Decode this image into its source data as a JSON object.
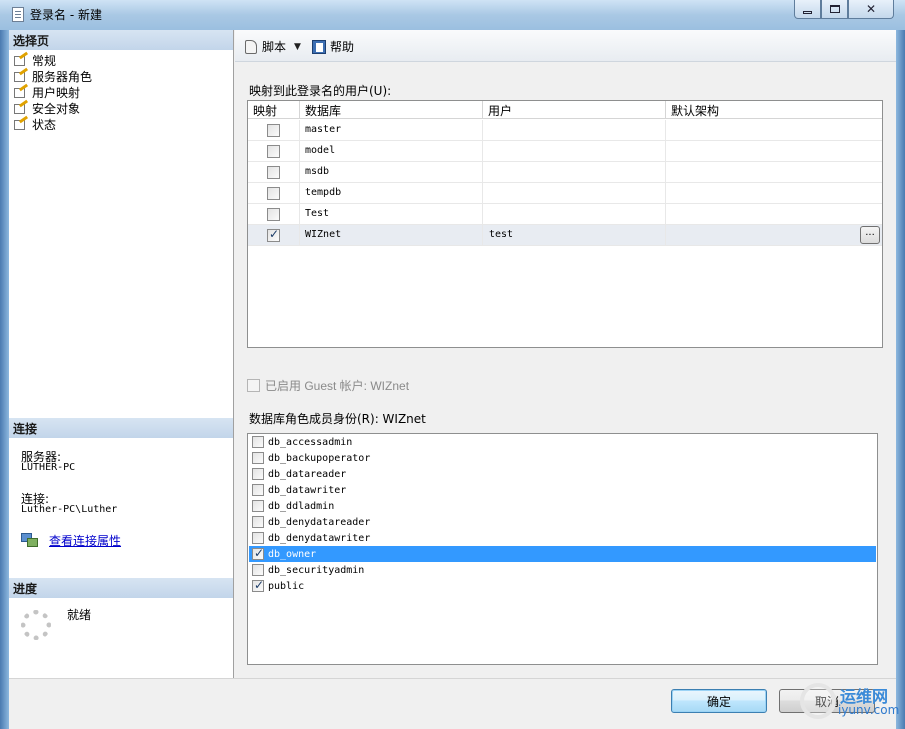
{
  "window": {
    "title": "登录名 - 新建"
  },
  "left": {
    "select_page_header": "选择页",
    "pages": [
      {
        "label": "常规"
      },
      {
        "label": "服务器角色"
      },
      {
        "label": "用户映射"
      },
      {
        "label": "安全对象"
      },
      {
        "label": "状态"
      }
    ],
    "connection_header": "连接",
    "server_label": "服务器:",
    "server_value": "LUTHER-PC",
    "connection_label": "连接:",
    "connection_value": "Luther-PC\\Luther",
    "view_props_link": "查看连接属性",
    "progress_header": "进度",
    "progress_status": "就绪"
  },
  "toolbar": {
    "script_label": "脚本",
    "help_label": "帮助"
  },
  "mapping": {
    "label": "映射到此登录名的用户(U):",
    "columns": [
      "映射",
      "数据库",
      "用户",
      "默认架构"
    ],
    "rows": [
      {
        "mapped": false,
        "database": "master",
        "user": "",
        "schema": ""
      },
      {
        "mapped": false,
        "database": "model",
        "user": "",
        "schema": ""
      },
      {
        "mapped": false,
        "database": "msdb",
        "user": "",
        "schema": ""
      },
      {
        "mapped": false,
        "database": "tempdb",
        "user": "",
        "schema": ""
      },
      {
        "mapped": false,
        "database": "Test",
        "user": "",
        "schema": ""
      },
      {
        "mapped": true,
        "database": "WIZnet",
        "user": "test",
        "schema": ""
      }
    ],
    "browse_button": "..."
  },
  "guest": {
    "label": "已启用 Guest 帐户: WIZnet"
  },
  "roles": {
    "label": "数据库角色成员身份(R): WIZnet",
    "items": [
      {
        "name": "db_accessadmin",
        "checked": false,
        "selected": false
      },
      {
        "name": "db_backupoperator",
        "checked": false,
        "selected": false
      },
      {
        "name": "db_datareader",
        "checked": false,
        "selected": false
      },
      {
        "name": "db_datawriter",
        "checked": false,
        "selected": false
      },
      {
        "name": "db_ddladmin",
        "checked": false,
        "selected": false
      },
      {
        "name": "db_denydatareader",
        "checked": false,
        "selected": false
      },
      {
        "name": "db_denydatawriter",
        "checked": false,
        "selected": false
      },
      {
        "name": "db_owner",
        "checked": true,
        "selected": true
      },
      {
        "name": "db_securityadmin",
        "checked": false,
        "selected": false
      },
      {
        "name": "public",
        "checked": true,
        "selected": false
      }
    ]
  },
  "buttons": {
    "ok": "确定",
    "cancel": "取消"
  },
  "watermark": {
    "line1": "运维网",
    "line2": "iyunv.com"
  }
}
